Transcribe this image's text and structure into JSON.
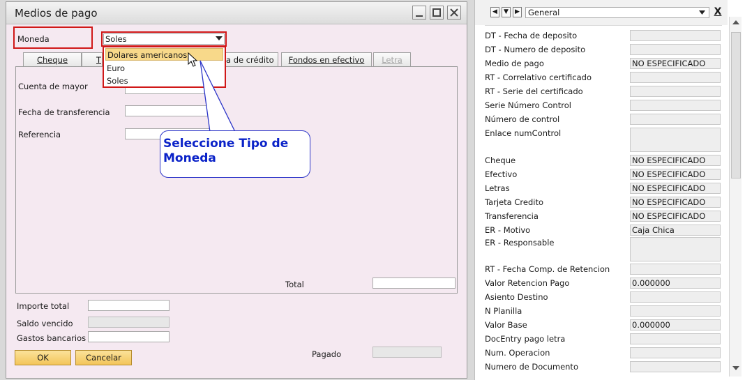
{
  "window": {
    "title": "Medios de pago"
  },
  "moneda": {
    "label": "Moneda",
    "selected": "Soles",
    "options": [
      "Dolares americanos",
      "Euro",
      "Soles"
    ]
  },
  "tabs": [
    {
      "label": "Cheque"
    },
    {
      "label": "T"
    },
    {
      "label": "a de crédito"
    },
    {
      "label": "Fondos en efectivo"
    },
    {
      "label": "Letra"
    }
  ],
  "form": {
    "cuenta_mayor": "Cuenta de mayor",
    "fecha_transferencia": "Fecha de transferencia",
    "referencia": "Referencia",
    "total": "Total"
  },
  "callout": {
    "text": "Seleccione Tipo de Moneda"
  },
  "summary": {
    "importe_total": "Importe total",
    "saldo_vencido": "Saldo vencido",
    "gastos_bancarios": "Gastos bancarios",
    "pagado": "Pagado"
  },
  "buttons": {
    "ok": "OK",
    "cancel": "Cancelar"
  },
  "right_panel": {
    "select_value": "General",
    "close_label": "X",
    "rows": [
      {
        "label": "DT - Fecha de deposito",
        "value": ""
      },
      {
        "label": "DT - Numero de deposito",
        "value": ""
      },
      {
        "label": "Medio de pago",
        "value": "NO ESPECIFICADO"
      },
      {
        "label": "RT - Correlativo certificado",
        "value": ""
      },
      {
        "label": "RT - Serie del certificado",
        "value": ""
      },
      {
        "label": "Serie Número Control",
        "value": ""
      },
      {
        "label": "Número de control",
        "value": ""
      },
      {
        "label": "Enlace numControl",
        "value": ""
      },
      {
        "label": "Cheque",
        "value": "NO ESPECIFICADO"
      },
      {
        "label": "Efectivo",
        "value": "NO ESPECIFICADO"
      },
      {
        "label": "Letras",
        "value": "NO ESPECIFICADO"
      },
      {
        "label": "Tarjeta Credito",
        "value": "NO ESPECIFICADO"
      },
      {
        "label": "Transferencia",
        "value": "NO ESPECIFICADO"
      },
      {
        "label": "ER - Motivo",
        "value": "Caja Chica"
      },
      {
        "label": "ER - Responsable",
        "value": ""
      },
      {
        "label": "RT - Fecha Comp. de Retencion",
        "value": ""
      },
      {
        "label": "Valor Retencion Pago",
        "value": "0.000000"
      },
      {
        "label": "Asiento Destino",
        "value": ""
      },
      {
        "label": "N Planilla",
        "value": ""
      },
      {
        "label": "Valor Base",
        "value": "0.000000"
      },
      {
        "label": "DocEntry pago letra",
        "value": ""
      },
      {
        "label": "Num. Operacion",
        "value": ""
      },
      {
        "label": "Numero de Documento",
        "value": ""
      }
    ]
  }
}
